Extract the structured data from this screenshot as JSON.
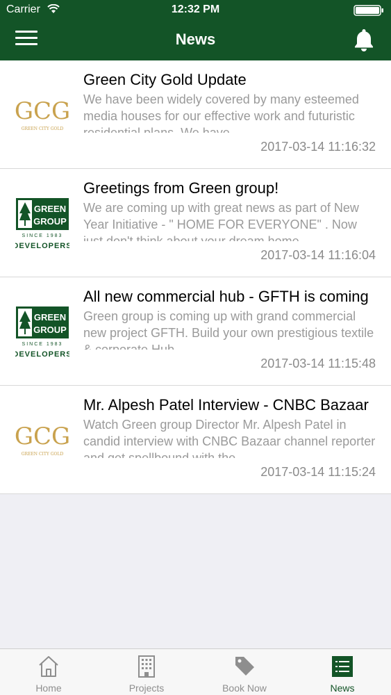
{
  "status_bar": {
    "carrier": "Carrier",
    "time": "12:32 PM"
  },
  "header": {
    "title": "News"
  },
  "news": [
    {
      "title": "Green City Gold Update",
      "body": "We have been widely covered by many esteemed media houses for our effective work and futuristic residential plans. We have",
      "date": "2017-03-14 11:16:32",
      "logo": "green-city-gold-logo",
      "logo_text": "GREEN CITY GOLD"
    },
    {
      "title": "Greetings from Green group!",
      "body": "We are coming up with great news as part of New Year Initiative - \" HOME FOR EVERYONE\" . Now just don't think about your dream home.",
      "date": "2017-03-14 11:16:04",
      "logo": "green-group-logo",
      "logo_text": "GREEN GROUP SINCE 1983 DEVELOPERS"
    },
    {
      "title": "All new commercial hub - GFTH is coming",
      "body": "Green group is coming up with grand commercial new project GFTH. Build your own prestigious textile & corporate Hub.",
      "date": "2017-03-14 11:15:48",
      "logo": "green-group-logo",
      "logo_text": "GREEN GROUP SINCE 1983 DEVELOPERS"
    },
    {
      "title": "Mr. Alpesh Patel Interview - CNBC Bazaar",
      "body": "Watch Green group Director Mr. Alpesh Patel in candid interview with CNBC Bazaar channel reporter and get spellbound with the",
      "date": "2017-03-14 11:15:24",
      "logo": "green-city-gold-logo",
      "logo_text": "GREEN CITY GOLD"
    }
  ],
  "tabs": [
    {
      "label": "Home",
      "icon": "home-icon"
    },
    {
      "label": "Projects",
      "icon": "building-icon"
    },
    {
      "label": "Book Now",
      "icon": "tag-icon"
    },
    {
      "label": "News",
      "icon": "list-icon",
      "active": true
    }
  ],
  "colors": {
    "brand_green": "#135427",
    "gold": "#c9a24e",
    "muted_text": "#9a9a9a"
  }
}
